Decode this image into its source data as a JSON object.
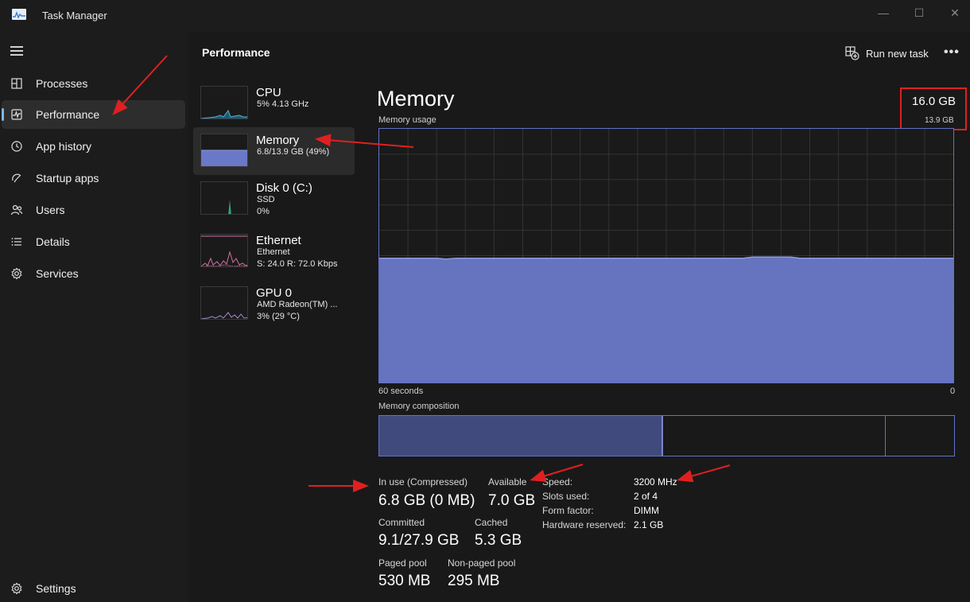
{
  "window": {
    "title": "Task Manager",
    "controls": {
      "minimize": "—",
      "maximize": "☐",
      "close": "✕"
    }
  },
  "sidebar": {
    "items": [
      {
        "label": "Processes",
        "icon": "processes-icon",
        "active": false
      },
      {
        "label": "Performance",
        "icon": "performance-icon",
        "active": true
      },
      {
        "label": "App history",
        "icon": "app-history-icon",
        "active": false
      },
      {
        "label": "Startup apps",
        "icon": "startup-apps-icon",
        "active": false
      },
      {
        "label": "Users",
        "icon": "users-icon",
        "active": false
      },
      {
        "label": "Details",
        "icon": "details-icon",
        "active": false
      },
      {
        "label": "Services",
        "icon": "services-icon",
        "active": false
      }
    ],
    "settings_label": "Settings"
  },
  "header": {
    "title": "Performance",
    "run_new_task": "Run new task",
    "more": "•••"
  },
  "devices": [
    {
      "name": "CPU",
      "line1": "5%  4.13 GHz",
      "line2": ""
    },
    {
      "name": "Memory",
      "line1": "6.8/13.9 GB (49%)",
      "line2": ""
    },
    {
      "name": "Disk 0 (C:)",
      "line1": "SSD",
      "line2": "0%"
    },
    {
      "name": "Ethernet",
      "line1": "Ethernet",
      "line2": "S: 24.0  R: 72.0 Kbps"
    },
    {
      "name": "GPU 0",
      "line1": "AMD Radeon(TM) ...",
      "line2": "3%  (29 °C)"
    }
  ],
  "memory": {
    "title": "Memory",
    "usage_label": "Memory usage",
    "total": "16.0 GB",
    "total_usable": "13.9 GB",
    "graph_x_left": "60 seconds",
    "graph_x_right": "0",
    "usage_fraction": 0.49,
    "composition_label": "Memory composition",
    "composition": {
      "in_use_fraction": 0.49,
      "available_fraction": 0.385,
      "rest_fraction": 0.125
    },
    "stats": {
      "in_use_label": "In use (Compressed)",
      "in_use_value": "6.8 GB (0 MB)",
      "available_label": "Available",
      "available_value": "7.0 GB",
      "committed_label": "Committed",
      "committed_value": "9.1/27.9 GB",
      "cached_label": "Cached",
      "cached_value": "5.3 GB",
      "paged_pool_label": "Paged pool",
      "paged_pool_value": "530 MB",
      "non_paged_pool_label": "Non-paged pool",
      "non_paged_pool_value": "295 MB"
    },
    "details": [
      {
        "label": "Speed:",
        "value": "3200 MHz"
      },
      {
        "label": "Slots used:",
        "value": "2 of 4"
      },
      {
        "label": "Form factor:",
        "value": "DIMM"
      },
      {
        "label": "Hardware reserved:",
        "value": "2.1 GB"
      }
    ]
  },
  "colors": {
    "accent": "#76b9ed",
    "memory_fill": "#6a78c8",
    "memory_border": "#6272c9",
    "annotation": "#e02020"
  }
}
